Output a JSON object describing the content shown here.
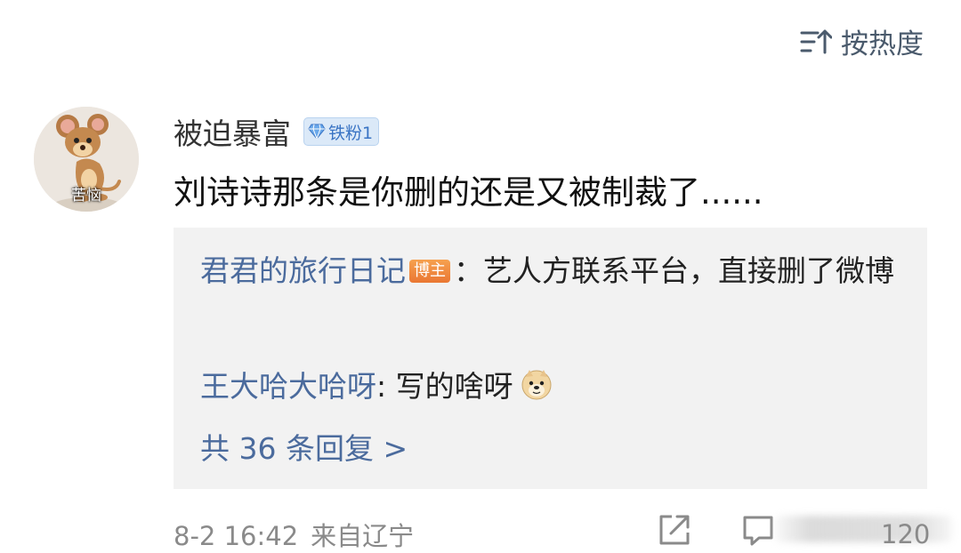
{
  "sort": {
    "label": "按热度",
    "icon": "sort-hot-icon"
  },
  "comment": {
    "avatar_label": "苦恼",
    "username": "被迫暴富",
    "fan_badge": "铁粉1",
    "text": "刘诗诗那条是你删的还是又被制裁了......",
    "date": "8-2 16:42",
    "location": "来自辽宁",
    "like_count": "120"
  },
  "replies": [
    {
      "user": "君君的旅行日记",
      "badge": "博主",
      "text": "：艺人方联系平台，直接删了微博"
    },
    {
      "user": "王大哈大哈呀",
      "text": ": 写的啥呀",
      "emoji": "doge-emoji-icon"
    }
  ],
  "view_replies": "共 36 条回复 >",
  "colors": {
    "link": "#4b6b9d",
    "meta": "#8a8a8a",
    "reply_bg": "#f2f2f2",
    "host_badge": "#ea7733",
    "fan_badge_bg": "#dbe9f8"
  }
}
